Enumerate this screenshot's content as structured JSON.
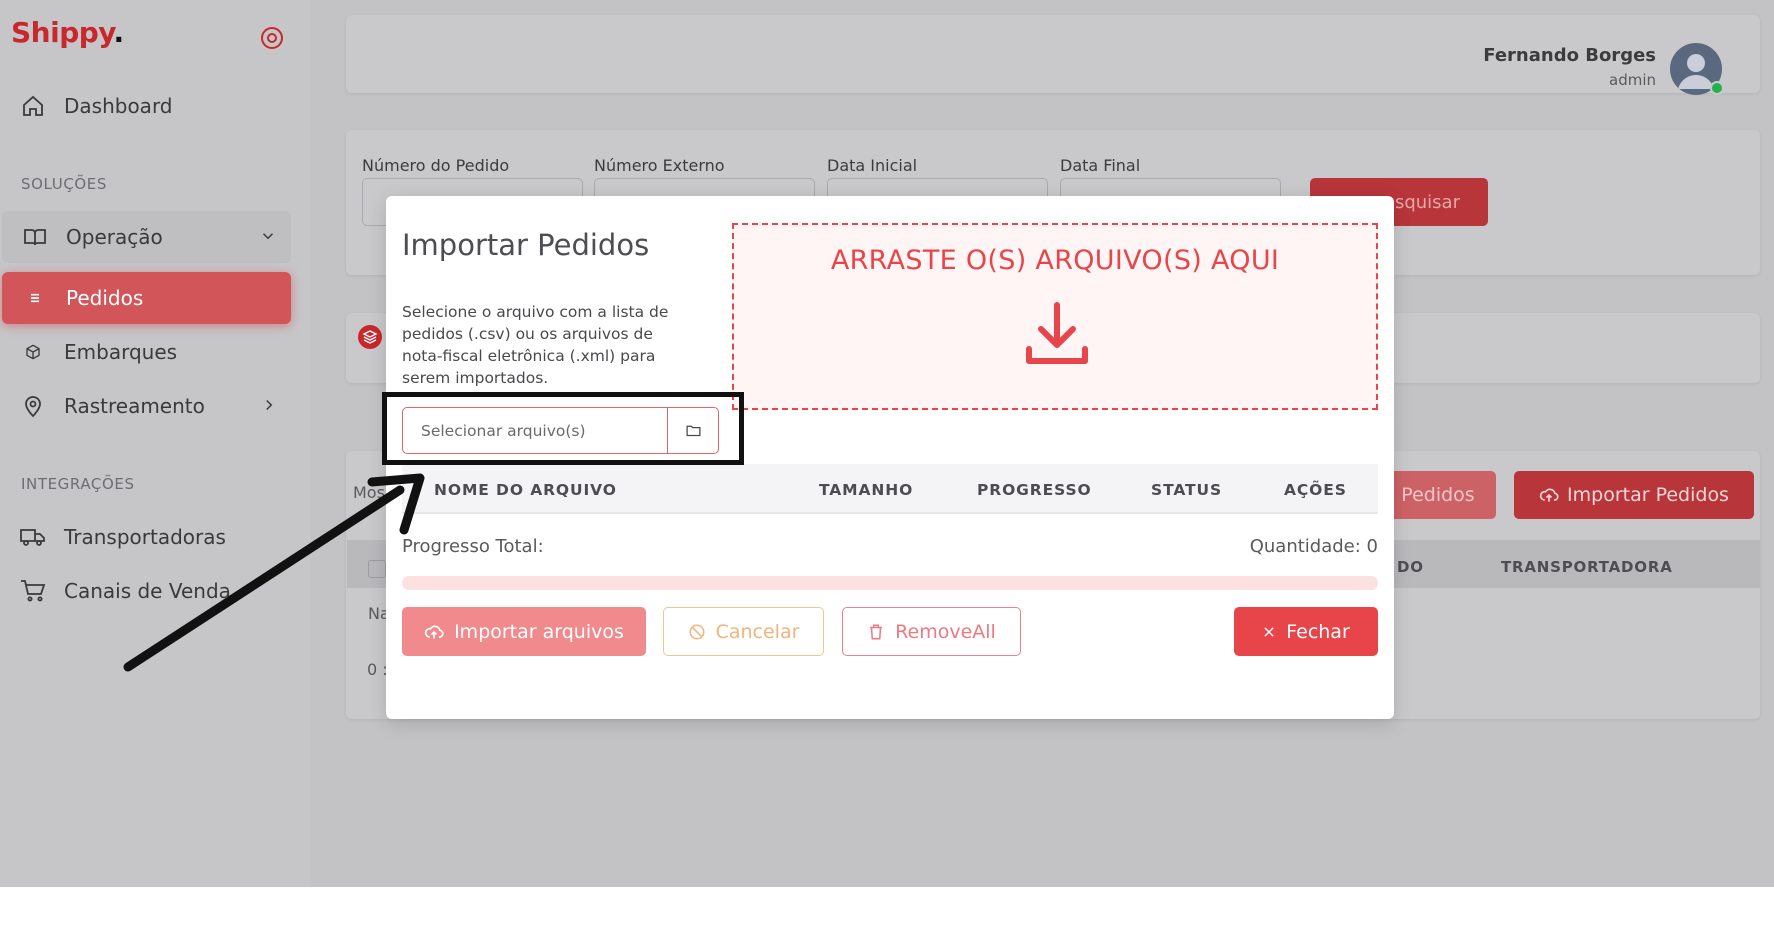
{
  "brand": {
    "name": "Shippy",
    "dot": ".",
    "accent": "#c8282c"
  },
  "header": {
    "user_name": "Fernando Borges",
    "user_role": "admin"
  },
  "sidebar": {
    "items": [
      {
        "label": "Dashboard",
        "icon": "home-icon"
      },
      {
        "section": "SOLUÇÕES"
      },
      {
        "label": "Operação",
        "icon": "book-open-icon"
      },
      {
        "label": "Pedidos",
        "icon": "list-icon",
        "active": true
      },
      {
        "label": "Embarques",
        "icon": "box-icon"
      },
      {
        "label": "Rastreamento",
        "icon": "map-pin-icon"
      },
      {
        "section": "INTEGRAÇÕES"
      },
      {
        "label": "Transportadoras",
        "icon": "truck-icon"
      },
      {
        "label": "Canais de Venda",
        "icon": "shopping-cart-icon"
      }
    ]
  },
  "filters": {
    "order_number": "Número do Pedido",
    "external_number": "Número Externo",
    "start_date": "Data Inicial",
    "end_date": "Data Final",
    "search_button": "esquisar"
  },
  "background": {
    "show_prefix": "Mos",
    "pedidos_button": "Pedidos",
    "import_button": "Importar Pedidos",
    "col_partial": "DO",
    "col_carrier": "TRANSPORTADORA",
    "row_text_1": "Na",
    "row_text_2": "0 :"
  },
  "modal": {
    "title": "Importar Pedidos",
    "description": "Selecione o arquivo com a lista de pedidos (.csv) ou os arquivos de nota-fiscal eletrônica (.xml) para serem importados.",
    "file_placeholder": "Selecionar arquivo(s)",
    "drop_text": "ARRASTE O(S) ARQUIVO(S) AQUI",
    "columns": [
      "NOME DO ARQUIVO",
      "TAMANHO",
      "PROGRESSO",
      "STATUS",
      "AÇÕES"
    ],
    "progress_label": "Progresso Total:",
    "quantity_label": "Quantidade: 0",
    "progress": 0,
    "buttons": {
      "import": "Importar arquivos",
      "cancel": "Cancelar",
      "remove_all": "RemoveAll",
      "close": "Fechar"
    }
  },
  "colors": {
    "primary": "#e8454b",
    "warning": "#f2b47c"
  }
}
